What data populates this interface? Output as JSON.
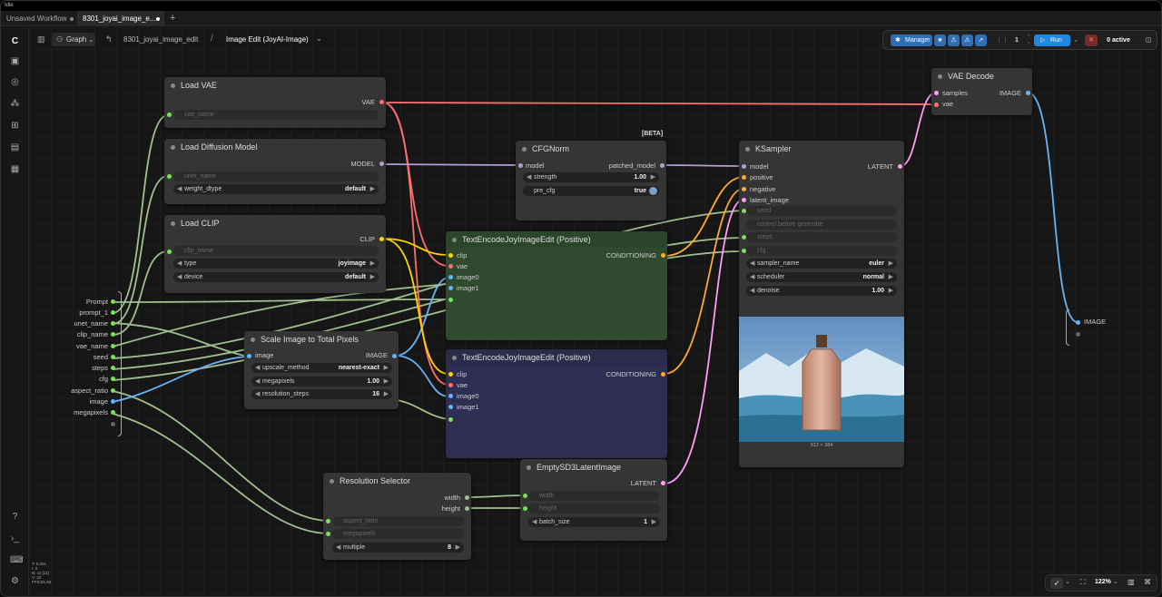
{
  "window": {
    "title": "Idle"
  },
  "tabs": [
    {
      "label": "Unsaved Workflow",
      "active": false
    },
    {
      "label": "8301_joyai_image_e...",
      "active": true
    }
  ],
  "new_tab": "+",
  "header": {
    "view_mode": "Graph",
    "breadcrumb_file": "8301_joyai_image_edit",
    "breadcrumb_sep": "/",
    "subgraph": "Image Edit (JoyAI-Image)"
  },
  "toolbar": {
    "manager": "Manager",
    "queue_count": "1",
    "run": "Run",
    "active": "0 active"
  },
  "zoom": "122%",
  "stats": [
    "T: 0.00s",
    "I: 0",
    "N: 11 [11]",
    "V: 22",
    "FPS:81.55"
  ],
  "colors": {
    "clip": "#ffd500",
    "vae": "#ff6e6e",
    "model": "#b39ddb",
    "conditioning": "#ffa931",
    "latent": "#ff9cf9",
    "image": "#64b5f6",
    "int": "#7be05a",
    "float": "#a0c090"
  },
  "group_inputs": [
    "Prompt",
    "prompt_1",
    "unet_name",
    "clip_name",
    "vae_name",
    "seed",
    "steps",
    "cfg",
    "aspect_ratio",
    "image",
    "megapixels"
  ],
  "group_output": "IMAGE",
  "nodes": {
    "load_vae": {
      "title": "Load VAE",
      "out": "VAE",
      "ph": "vae_name"
    },
    "load_diff": {
      "title": "Load Diffusion Model",
      "out": "MODEL",
      "ph": "unet_name",
      "w_label": "weight_dtype",
      "w_value": "default"
    },
    "load_clip": {
      "title": "Load CLIP",
      "out": "CLIP",
      "ph": "clip_name",
      "type_label": "type",
      "type_value": "joyimage",
      "device_label": "device",
      "device_value": "default"
    },
    "cfgnorm": {
      "title": "CFGNorm",
      "badge": "[BETA]",
      "in": "model",
      "out": "patched_model",
      "strength_label": "strength",
      "strength_value": "1.00",
      "pre_label": "pre_cfg",
      "pre_value": "true"
    },
    "te_pos1": {
      "title": "TextEncodeJoyImageEdit (Positive)",
      "in": [
        "clip",
        "vae",
        "image0",
        "image1"
      ],
      "out": "CONDITIONING"
    },
    "te_pos2": {
      "title": "TextEncodeJoyImageEdit (Positive)",
      "in": [
        "clip",
        "vae",
        "image0",
        "image1"
      ],
      "out": "CONDITIONING"
    },
    "scale": {
      "title": "Scale Image to Total Pixels",
      "in": "image",
      "out": "IMAGE",
      "w1_label": "upscale_method",
      "w1_value": "nearest-exact",
      "w2_label": "megapixels",
      "w2_value": "1.00",
      "w3_label": "resolution_steps",
      "w3_value": "16"
    },
    "ksampler": {
      "title": "KSampler",
      "in": [
        "model",
        "positive",
        "negative",
        "latent_image"
      ],
      "out": "LATENT",
      "ph": [
        "seed",
        "control before generate",
        "steps",
        "cfg"
      ],
      "sampler_label": "sampler_name",
      "sampler_value": "euler",
      "sched_label": "scheduler",
      "sched_value": "normal",
      "denoise_label": "denoise",
      "denoise_value": "1.00",
      "preview_caption": "512 × 384"
    },
    "vae_decode": {
      "title": "VAE Decode",
      "in": [
        "samples",
        "vae"
      ],
      "out": "IMAGE"
    },
    "res_sel": {
      "title": "Resolution Selector",
      "out": [
        "width",
        "height"
      ],
      "ph": [
        "aspect_ratio",
        "megapixels"
      ],
      "mult_label": "multiple",
      "mult_value": "8"
    },
    "latent": {
      "title": "EmptySD3LatentImage",
      "out": "LATENT",
      "ph": [
        "width",
        "height"
      ],
      "batch_label": "batch_size",
      "batch_value": "1"
    }
  }
}
